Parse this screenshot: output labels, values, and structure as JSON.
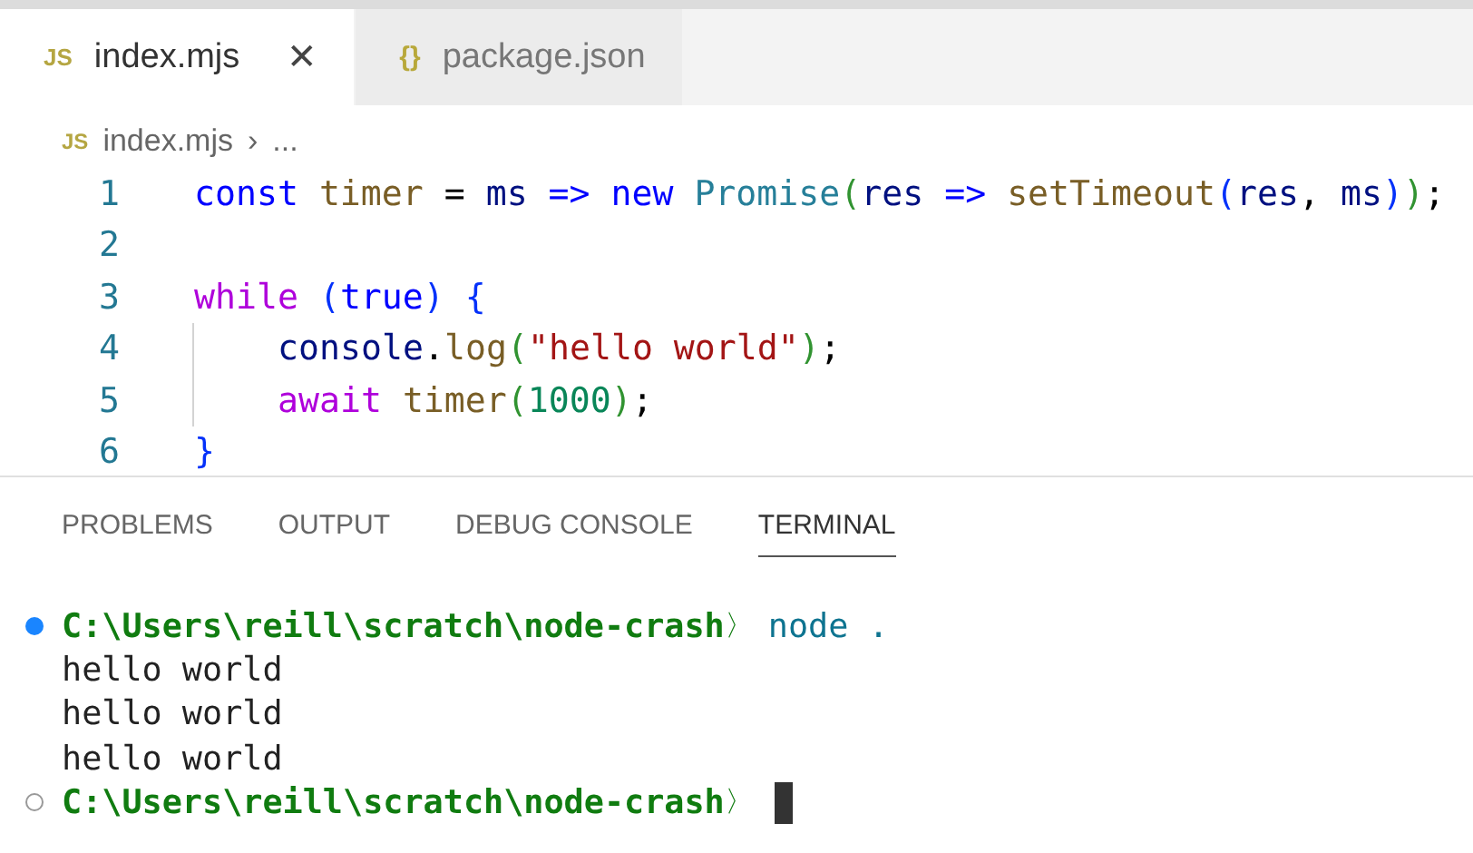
{
  "editor_tabs": [
    {
      "icon": "JS",
      "label": "index.mjs",
      "selected": true,
      "close": "✕"
    },
    {
      "icon": "{}",
      "label": "package.json",
      "selected": false
    }
  ],
  "breadcrumb": {
    "icon": "JS",
    "file": "index.mjs",
    "separator": "›",
    "rest": "..."
  },
  "code_lines": [
    {
      "number": "1",
      "tokens": [
        {
          "kind": "keyword",
          "text": "const"
        },
        {
          "kind": "func",
          "text": "timer",
          "gap": true
        },
        {
          "kind": "plain",
          "text": "=",
          "gap": true
        },
        {
          "kind": "var",
          "text": "ms",
          "gap": true
        },
        {
          "kind": "keyword",
          "text": "=>",
          "gap": true
        },
        {
          "kind": "keyword",
          "text": "new",
          "gap": true
        },
        {
          "kind": "type",
          "text": "Promise",
          "gap": true
        },
        {
          "kind": "bracket",
          "text": "("
        },
        {
          "kind": "var",
          "text": "res"
        },
        {
          "kind": "keyword",
          "text": "=>",
          "gap": true
        },
        {
          "kind": "func",
          "text": "setTimeout",
          "gap": true
        },
        {
          "kind": "bracket2",
          "text": "("
        },
        {
          "kind": "var",
          "text": "res"
        },
        {
          "kind": "plain",
          "text": ","
        },
        {
          "kind": "var",
          "text": "ms",
          "gap": true
        },
        {
          "kind": "bracket2",
          "text": ")"
        },
        {
          "kind": "bracket",
          "text": ")"
        },
        {
          "kind": "plain",
          "text": ";"
        }
      ]
    },
    {
      "number": "2"
    },
    {
      "number": "3",
      "tokens": [
        {
          "kind": "control",
          "text": "while"
        },
        {
          "kind": "bracket2",
          "text": "(",
          "gap": true
        },
        {
          "kind": "keyword",
          "text": "true"
        },
        {
          "kind": "bracket2",
          "text": ")"
        },
        {
          "kind": "bracket2",
          "text": "{",
          "gap": true
        }
      ],
      "children": [
        {
          "number": "4",
          "tokens": [
            {
              "kind": "var",
              "text": "console"
            },
            {
              "kind": "plain",
              "text": "."
            },
            {
              "kind": "func",
              "text": "log"
            },
            {
              "kind": "bracket",
              "text": "("
            },
            {
              "kind": "string",
              "text": "\"hello world\""
            },
            {
              "kind": "bracket",
              "text": ")"
            },
            {
              "kind": "plain",
              "text": ";"
            }
          ]
        },
        {
          "number": "5",
          "tokens": [
            {
              "kind": "control",
              "text": "await"
            },
            {
              "kind": "func",
              "text": "timer",
              "gap": true
            },
            {
              "kind": "bracket",
              "text": "("
            },
            {
              "kind": "number",
              "text": "1000"
            },
            {
              "kind": "bracket",
              "text": ")"
            },
            {
              "kind": "plain",
              "text": ";"
            }
          ]
        }
      ]
    },
    {
      "number": "6",
      "tokens": [
        {
          "kind": "bracket2",
          "text": "}"
        }
      ]
    }
  ],
  "panel_tabs": [
    {
      "label": "PROBLEMS",
      "selected": false
    },
    {
      "label": "OUTPUT",
      "selected": false
    },
    {
      "label": "DEBUG CONSOLE",
      "selected": false
    },
    {
      "label": "TERMINAL",
      "selected": true
    }
  ],
  "terminal_lines": [
    {
      "kind": "prompt",
      "command_done": true,
      "path": "C:\\Users\\reill\\scratch\\node-crash",
      "arrow": "〉",
      "command": "node .",
      "cursor": false
    },
    {
      "kind": "output",
      "text": "hello world"
    },
    {
      "kind": "output",
      "text": "hello world"
    },
    {
      "kind": "output",
      "text": "hello world"
    },
    {
      "kind": "prompt",
      "command_done": false,
      "path": "C:\\Users\\reill\\scratch\\node-crash",
      "arrow": "〉",
      "cursor": true
    }
  ]
}
